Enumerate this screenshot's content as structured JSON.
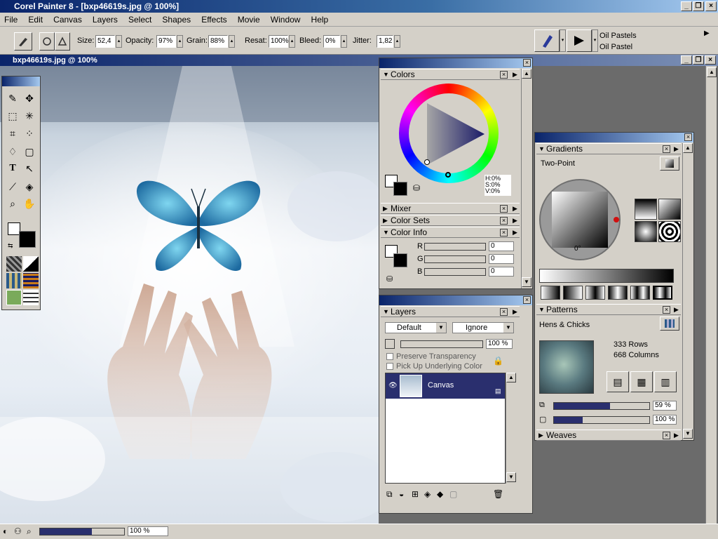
{
  "app": {
    "title": "Corel Painter 8 - [bxp46619s.jpg @ 100%]"
  },
  "menu": [
    "File",
    "Edit",
    "Canvas",
    "Layers",
    "Select",
    "Shapes",
    "Effects",
    "Movie",
    "Window",
    "Help"
  ],
  "property_bar": {
    "size_label": "Size:",
    "size_value": "52,4",
    "opacity_label": "Opacity:",
    "opacity_value": "97%",
    "grain_label": "Grain:",
    "grain_value": "88%",
    "resat_label": "Resat:",
    "resat_value": "100%",
    "bleed_label": "Bleed:",
    "bleed_value": "0%",
    "jitter_label": "Jitter:",
    "jitter_value": "1,82",
    "brush_category": "Oil Pastels",
    "brush_variant": "Oil Pastel"
  },
  "document": {
    "title": "bxp46619s.jpg @ 100%",
    "zoom": "100 %"
  },
  "colors_panel": {
    "title": "Colors",
    "hsv": [
      "H:0%",
      "S:0%",
      "V:0%"
    ]
  },
  "sections": {
    "mixer": "Mixer",
    "color_sets": "Color Sets",
    "color_info": "Color Info"
  },
  "color_info": {
    "r_label": "R",
    "g_label": "G",
    "b_label": "B",
    "r": "0",
    "g": "0",
    "b": "0"
  },
  "layers_panel": {
    "title": "Layers",
    "composite_method": "Default",
    "depth": "Ignore",
    "opacity": "100 %",
    "preserve_transparency": "Preserve Transparency",
    "pick_up_underlying": "Pick Up Underlying Color",
    "layer_name": "Canvas"
  },
  "gradients_panel": {
    "title": "Gradients",
    "type": "Two-Point",
    "angle": "0°"
  },
  "patterns_panel": {
    "title": "Patterns",
    "name": "Hens & Chicks",
    "rows": "333 Rows",
    "columns": "668 Columns",
    "scale": "59 %",
    "opacity": "100 %"
  },
  "weaves_panel": {
    "title": "Weaves"
  },
  "colors": {
    "accent": "#0a246a",
    "chrome": "#d4d0c8",
    "layer_selected": "#2a2f6e"
  }
}
